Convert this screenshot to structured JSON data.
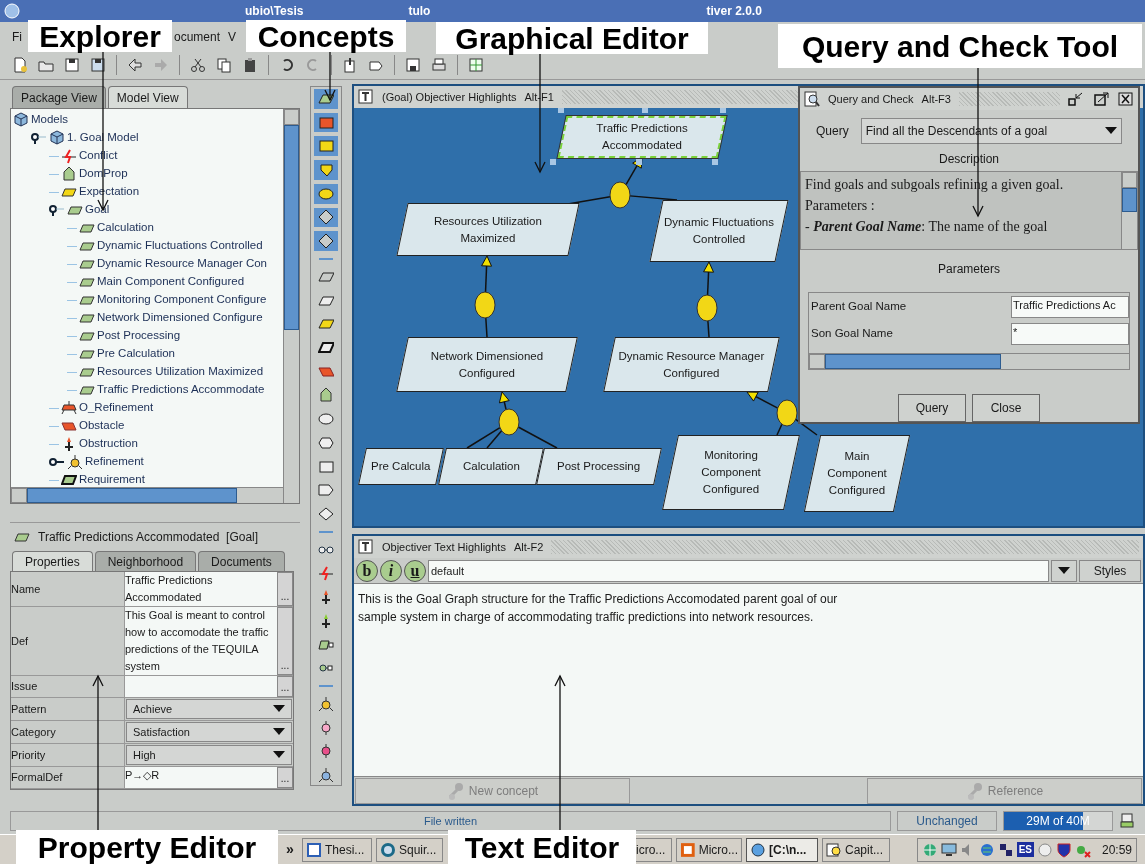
{
  "title_bar": {
    "texts": [
      "ubio\\Tesis",
      "tulo",
      "tiver 2.0.0"
    ]
  },
  "menu": [
    "Fi",
    "ocument",
    "V"
  ],
  "callouts": [
    "Explorer",
    "Concepts",
    "Graphical Editor",
    "Query and Check Tool",
    "Property Editor",
    "Text Editor"
  ],
  "explorer": {
    "tabs": [
      {
        "label": "Package View",
        "selected": false
      },
      {
        "label": "Model View",
        "selected": true
      }
    ],
    "tree": [
      {
        "label": "Models",
        "kind": "model",
        "children": [
          {
            "label": "1. Goal Model",
            "kind": "model",
            "expanded": true,
            "children": [
              {
                "label": "Conflict",
                "kind": "conflict"
              },
              {
                "label": "DomProp",
                "kind": "domprop"
              },
              {
                "label": "Expectation",
                "kind": "expectation"
              },
              {
                "label": "Goal",
                "kind": "goal",
                "expanded": true,
                "children": [
                  {
                    "label": "Calculation",
                    "kind": "goal"
                  },
                  {
                    "label": "Dynamic Fluctuations Controlled",
                    "kind": "goal"
                  },
                  {
                    "label": "Dynamic Resource Manager Con",
                    "kind": "goal"
                  },
                  {
                    "label": "Main Component Configured",
                    "kind": "goal"
                  },
                  {
                    "label": "Monitoring Component Configure",
                    "kind": "goal"
                  },
                  {
                    "label": "Network Dimensioned Configure",
                    "kind": "goal"
                  },
                  {
                    "label": "Post Processing",
                    "kind": "goal"
                  },
                  {
                    "label": "Pre Calculation",
                    "kind": "goal"
                  },
                  {
                    "label": "Resources Utilization Maximized",
                    "kind": "goal"
                  },
                  {
                    "label": "Traffic Predictions Accommodate",
                    "kind": "goal"
                  }
                ]
              },
              {
                "label": "O_Refinement",
                "kind": "o_refinement"
              },
              {
                "label": "Obstacle",
                "kind": "obstacle"
              },
              {
                "label": "Obstruction",
                "kind": "obstruction"
              },
              {
                "label": "Refinement",
                "kind": "refinement",
                "expanded": false
              },
              {
                "label": "Requirement",
                "kind": "requirement"
              }
            ]
          }
        ]
      }
    ]
  },
  "property_editor": {
    "heading": "Traffic Predictions Accommodated  [Goal]",
    "tabs": [
      {
        "label": "Properties",
        "selected": true
      },
      {
        "label": "Neighborhood",
        "selected": false
      },
      {
        "label": "Documents",
        "selected": false
      }
    ],
    "rows": [
      {
        "name": "Name",
        "kind": "text",
        "value": "Traffic Predictions Accommodated",
        "button": "..."
      },
      {
        "name": "Def",
        "kind": "text",
        "value": "This Goal is meant to control how to accomodate the traffic predictions of the TEQUILA system",
        "button": "..."
      },
      {
        "name": "Issue",
        "kind": "text",
        "button": "..."
      },
      {
        "name": "Pattern",
        "kind": "select",
        "value": "Achieve"
      },
      {
        "name": "Category",
        "kind": "select",
        "value": "Satisfaction"
      },
      {
        "name": "Priority",
        "kind": "select",
        "value": "High"
      },
      {
        "name": "FormalDef",
        "kind": "text",
        "value": "P→◇R",
        "button": "..."
      }
    ]
  },
  "graph_editor": {
    "title": "(Goal) Objectiver Highlights",
    "shortcut": "Alt-F1",
    "nodes": [
      {
        "label": "Traffic Predictions Accommodated",
        "selected": true
      },
      {
        "label": "Resources Utilization Maximized",
        "selected": false
      },
      {
        "label": "Dynamic Fluctuations Controlled",
        "selected": false
      },
      {
        "label": "Network Dimensioned Configured",
        "selected": false
      },
      {
        "label": "Dynamic Resource Manager Configured",
        "selected": false
      },
      {
        "label": "Pre Calcula",
        "selected": false
      },
      {
        "label": "Calculation",
        "selected": false
      },
      {
        "label": "Post Processing",
        "selected": false
      },
      {
        "label": "Monitoring Component Configured",
        "selected": false
      },
      {
        "label": "Main Component Configured",
        "selected": false
      }
    ]
  },
  "query_tool": {
    "title": "Query and Check",
    "shortcut": "Alt-F3",
    "query_label": "Query",
    "query": "Find all the Descendants of a goal",
    "description_label": "Description",
    "description": [
      "Find goals and subgoals refining a given goal.",
      "Parameters :",
      "- **Parent Goal Name**: The name of the goal"
    ],
    "parameters_label": "Parameters",
    "parameters": [
      {
        "name": "Parent Goal Name",
        "value": "Traffic Predictions Ac"
      },
      {
        "name": "Son Goal Name",
        "value": "*"
      }
    ],
    "buttons": [
      "Query",
      "Close"
    ]
  },
  "text_editor": {
    "title": "Objectiver Text Highlights",
    "shortcut": "Alt-F2",
    "format_buttons": [
      "b",
      "i",
      "u"
    ],
    "style": "default",
    "styles_button": "Styles",
    "text": "This is the Goal Graph structure for the Traffic Predictions Accomodated parent goal of our sample system in charge of accommodating traffic predictions into network resources.",
    "actions": [
      {
        "label": "New concept",
        "disabled": true
      },
      {
        "label": "Reference",
        "disabled": true
      }
    ]
  },
  "status_bar": {
    "message": "File written",
    "state": "Unchanged",
    "memory": {
      "reading": "29M of 40M",
      "level": 0.73
    }
  },
  "taskbar": {
    "more": "»",
    "tasks": [
      {
        "label": "Thesi...",
        "selected": false
      },
      {
        "label": "Squir...",
        "selected": false
      },
      {
        "label": "icro...",
        "selected": false
      },
      {
        "label": "Micro...",
        "selected": false
      },
      {
        "label": "[C:\\n...",
        "selected": true
      },
      {
        "label": "Capit...",
        "selected": false
      }
    ],
    "language": "ES",
    "clock": "20:59"
  }
}
